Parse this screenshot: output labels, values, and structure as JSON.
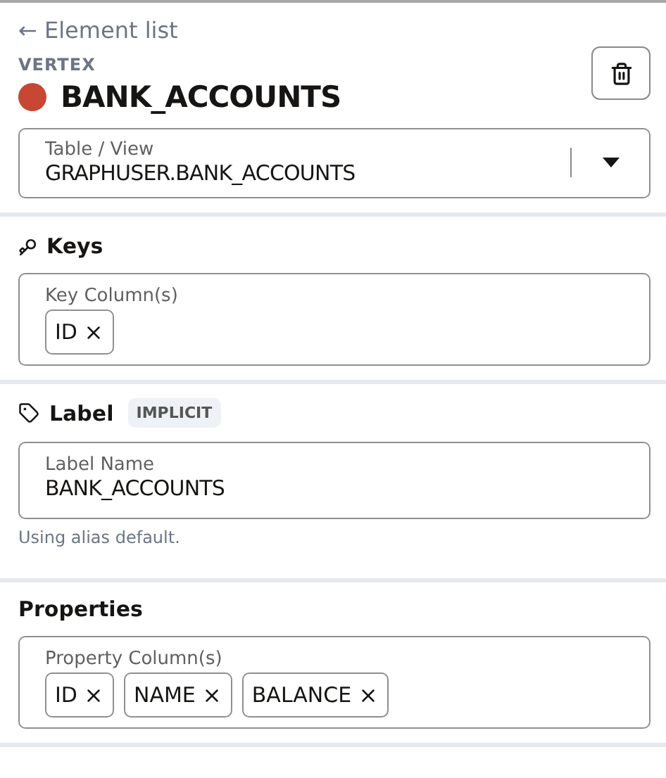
{
  "back_link": "← Element list",
  "element_type": "VERTEX",
  "element": {
    "name": "BANK_ACCOUNTS",
    "color": "#c74634"
  },
  "table_view": {
    "label": "Table / View",
    "value": "GRAPHUSER.BANK_ACCOUNTS"
  },
  "sections": [
    {
      "kind": "chips",
      "heading": "Keys",
      "field_label": "Key Column(s)",
      "chips": [
        "ID"
      ]
    },
    {
      "kind": "text",
      "heading": "Label",
      "badge": "IMPLICIT",
      "field_label": "Label Name",
      "value": "BANK_ACCOUNTS",
      "helper": "Using alias default."
    },
    {
      "kind": "chips",
      "heading": "Properties",
      "field_label": "Property Column(s)",
      "chips": [
        "ID",
        "NAME",
        "BALANCE"
      ]
    }
  ]
}
